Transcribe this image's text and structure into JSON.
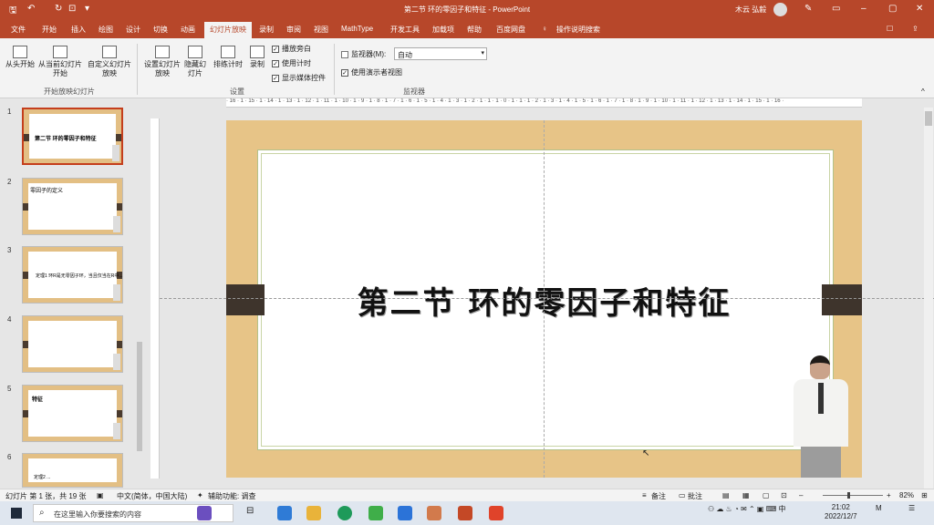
{
  "titlebar": {
    "title": "第二节 环的零因子和特征  -  PowerPoint",
    "user": "木云 弘毅"
  },
  "menu_tabs": [
    "文件",
    "开始",
    "插入",
    "绘图",
    "设计",
    "切换",
    "动画",
    "幻灯片放映",
    "录制",
    "审阅",
    "视图",
    "MathType",
    "开发工具",
    "加载项",
    "帮助",
    "百度网盘",
    "操作说明搜索"
  ],
  "ribbon": {
    "start_group": {
      "buttons": [
        "从头开始",
        "从当前幻灯片开始",
        "自定义幻灯片放映"
      ],
      "label": "开始放映幻灯片"
    },
    "setup_group": {
      "buttons": [
        "设置幻灯片放映",
        "隐藏幻灯片",
        "排练计时",
        "录制"
      ],
      "checkboxes": [
        "播放旁白",
        "使用计时",
        "显示媒体控件"
      ],
      "label": "设置"
    },
    "monitor_group": {
      "monitor_label": "监视器(M):",
      "monitor_value": "自动",
      "presenter_view": "使用演示者视图",
      "label": "监视器"
    }
  },
  "ruler": {
    "h_ticks": "· 16 · 1 · 15 · 1 · 14 · 1 · 13 · 1 · 12 · 1 · 11 · 1 · 10 · 1 · 9 · 1 · 8 · 1 · 7 · 1 · 6 · 1 · 5 · 1 · 4 · 1 · 3 · 1 · 2 · 1 · 1 · 1 · 0 · 1 · 1 · 1 · 2 · 1 · 3 · 1 · 4 · 1 · 5 · 1 · 6 · 1 · 7 · 1 · 8 · 1 · 9 · 1 · 10 · 1 · 11 · 1 · 12 · 1 · 13 · 1 · 14 · 1 · 15 · 1 · 16 ·"
  },
  "thumbnails": [
    {
      "num": "1",
      "text": "第二节 环的零因子和特征"
    },
    {
      "num": "2",
      "text": "零因子的定义"
    },
    {
      "num": "3",
      "text": "定理1  环R是无零因子环，当且仅当在R中..."
    },
    {
      "num": "4",
      "text": ""
    },
    {
      "num": "5",
      "text": "特征"
    },
    {
      "num": "6",
      "text": "定理2  ..."
    }
  ],
  "slide": {
    "title": "第二节 环的零因子和特征"
  },
  "status": {
    "slide_info": "幻灯片 第 1 张，共 19 张",
    "language": "中文(简体，中国大陆)",
    "accessibility": "辅助功能: 调查",
    "notes": "备注",
    "comments": "批注",
    "zoom": "82%"
  },
  "taskbar": {
    "search_placeholder": "在这里输入你要搜索的内容",
    "time": "21:02",
    "date": "2022/12/7"
  },
  "colors": {
    "accent": "#b7472a",
    "slide_bg": "#e7c487",
    "tab_dark": "#3e342c"
  }
}
